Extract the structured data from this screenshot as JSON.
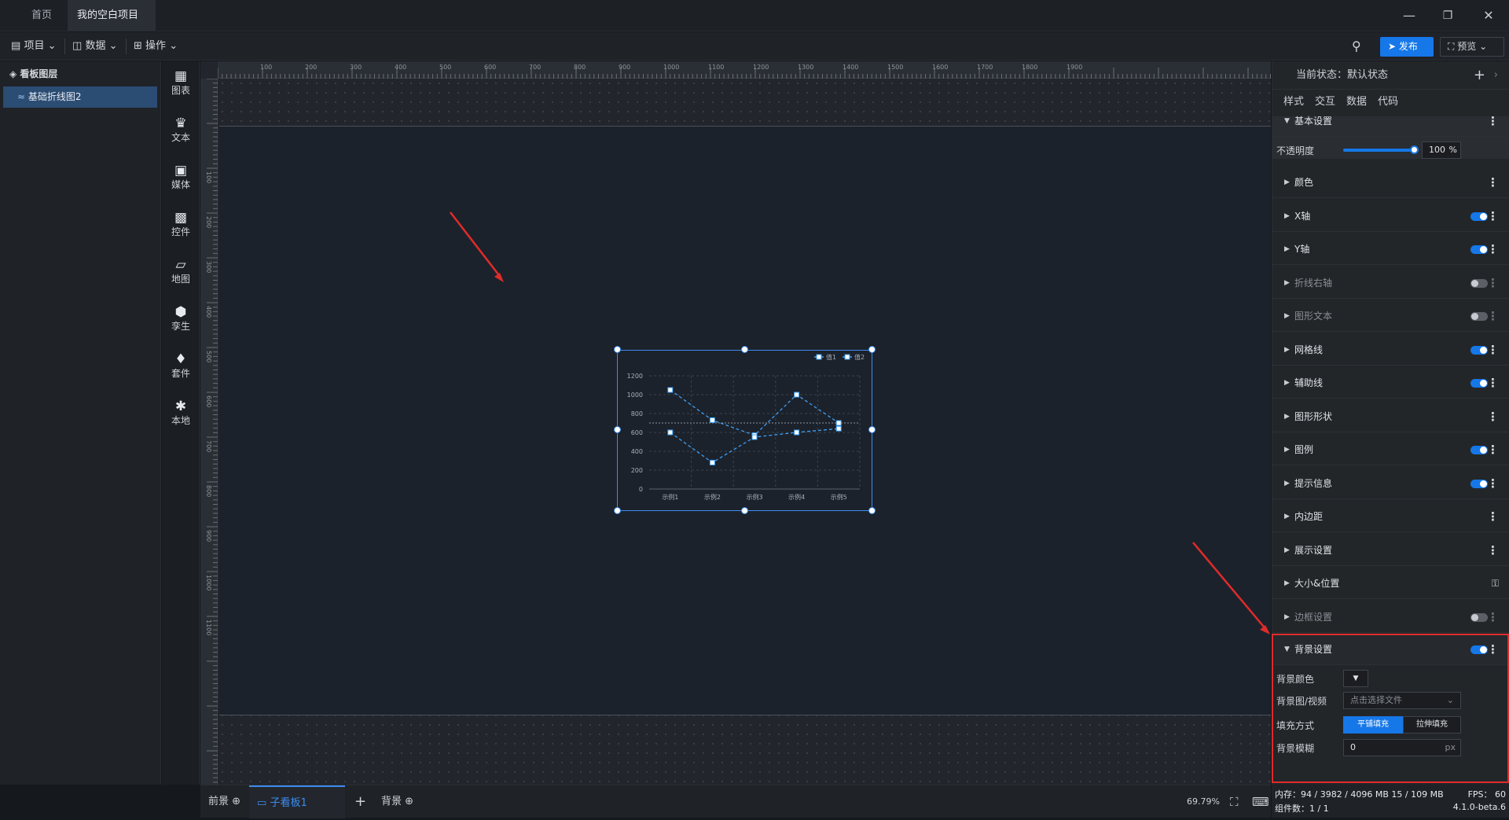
{
  "tabs": {
    "home": "首页",
    "project": "我的空白项目"
  },
  "toolbar": {
    "project": "项目",
    "data": "数据",
    "operate": "操作",
    "publish": "发布",
    "preview": "预览"
  },
  "layers": {
    "title": "看板图层",
    "items": [
      "基础折线图2"
    ]
  },
  "components": [
    {
      "label": "图表",
      "icon": "chart-icon"
    },
    {
      "label": "文本",
      "icon": "text-icon"
    },
    {
      "label": "媒体",
      "icon": "media-icon"
    },
    {
      "label": "控件",
      "icon": "control-icon"
    },
    {
      "label": "地图",
      "icon": "map-icon"
    },
    {
      "label": "孪生",
      "icon": "twin-icon"
    },
    {
      "label": "套件",
      "icon": "kit-icon"
    },
    {
      "label": "本地",
      "icon": "local-icon"
    }
  ],
  "ruler": {
    "top": [
      "100",
      "200",
      "300",
      "400",
      "500",
      "600",
      "700",
      "800",
      "900",
      "1000",
      "1100",
      "1200",
      "1300",
      "1400",
      "1500",
      "1600",
      "1700",
      "1800",
      "1900"
    ],
    "left": [
      "100",
      "200",
      "300",
      "400",
      "500",
      "600",
      "700",
      "800",
      "900",
      "1000",
      "1100"
    ]
  },
  "chart_data": {
    "type": "line",
    "categories": [
      "示例1",
      "示例2",
      "示例3",
      "示例4",
      "示例5"
    ],
    "series": [
      {
        "name": "值1",
        "values": [
          1050,
          730,
          570,
          1000,
          700
        ]
      },
      {
        "name": "值2",
        "values": [
          600,
          280,
          550,
          600,
          640
        ]
      }
    ],
    "yticks": [
      "1200",
      "1000",
      "800",
      "600",
      "400",
      "200",
      "0"
    ],
    "ylim": [
      0,
      1200
    ],
    "legend": "top-right",
    "colors": {
      "line": "#3d9ef5"
    }
  },
  "bottom": {
    "front": "前景",
    "board": "子看板1",
    "back": "背景",
    "zoom": "69.79%"
  },
  "props": {
    "state": "当前状态：默认状态",
    "tabs": [
      "样式",
      "交互",
      "数据",
      "代码"
    ],
    "basic": "基本设置",
    "opacity_label": "不透明度",
    "opacity_value": "100",
    "opacity_unit": "%",
    "opacity_fraction": 1.0,
    "sections": [
      {
        "label": "颜色",
        "toggle": "none",
        "dim": false
      },
      {
        "label": "X轴",
        "toggle": "on",
        "dim": false
      },
      {
        "label": "Y轴",
        "toggle": "on",
        "dim": false
      },
      {
        "label": "折线右轴",
        "toggle": "off",
        "dim": true
      },
      {
        "label": "图形文本",
        "toggle": "off",
        "dim": true
      },
      {
        "label": "网格线",
        "toggle": "on",
        "dim": false
      },
      {
        "label": "辅助线",
        "toggle": "on",
        "dim": false
      },
      {
        "label": "图形形状",
        "toggle": "none",
        "dim": false
      },
      {
        "label": "图例",
        "toggle": "on",
        "dim": false
      },
      {
        "label": "提示信息",
        "toggle": "on",
        "dim": false
      },
      {
        "label": "内边距",
        "toggle": "none",
        "dim": false
      },
      {
        "label": "展示设置",
        "toggle": "none",
        "dim": false
      },
      {
        "label": "大小&位置",
        "toggle": "lock",
        "dim": false
      },
      {
        "label": "边框设置",
        "toggle": "off",
        "dim": true
      }
    ],
    "bg": {
      "title": "背景设置",
      "color_label": "背景颜色",
      "image_label": "背景图/视频",
      "image_placeholder": "点击选择文件",
      "fill_label": "填充方式",
      "fill_tile": "平铺填充",
      "fill_stretch": "拉伸填充",
      "blur_label": "背景模糊",
      "blur_value": "0",
      "blur_unit": "px"
    }
  },
  "status": {
    "memory": "内存：94 / 3982 / 4096 MB 15 / 109 MB",
    "fps": "FPS： 60",
    "count": "组件数：1 / 1",
    "version": "4.1.0-beta.6"
  }
}
